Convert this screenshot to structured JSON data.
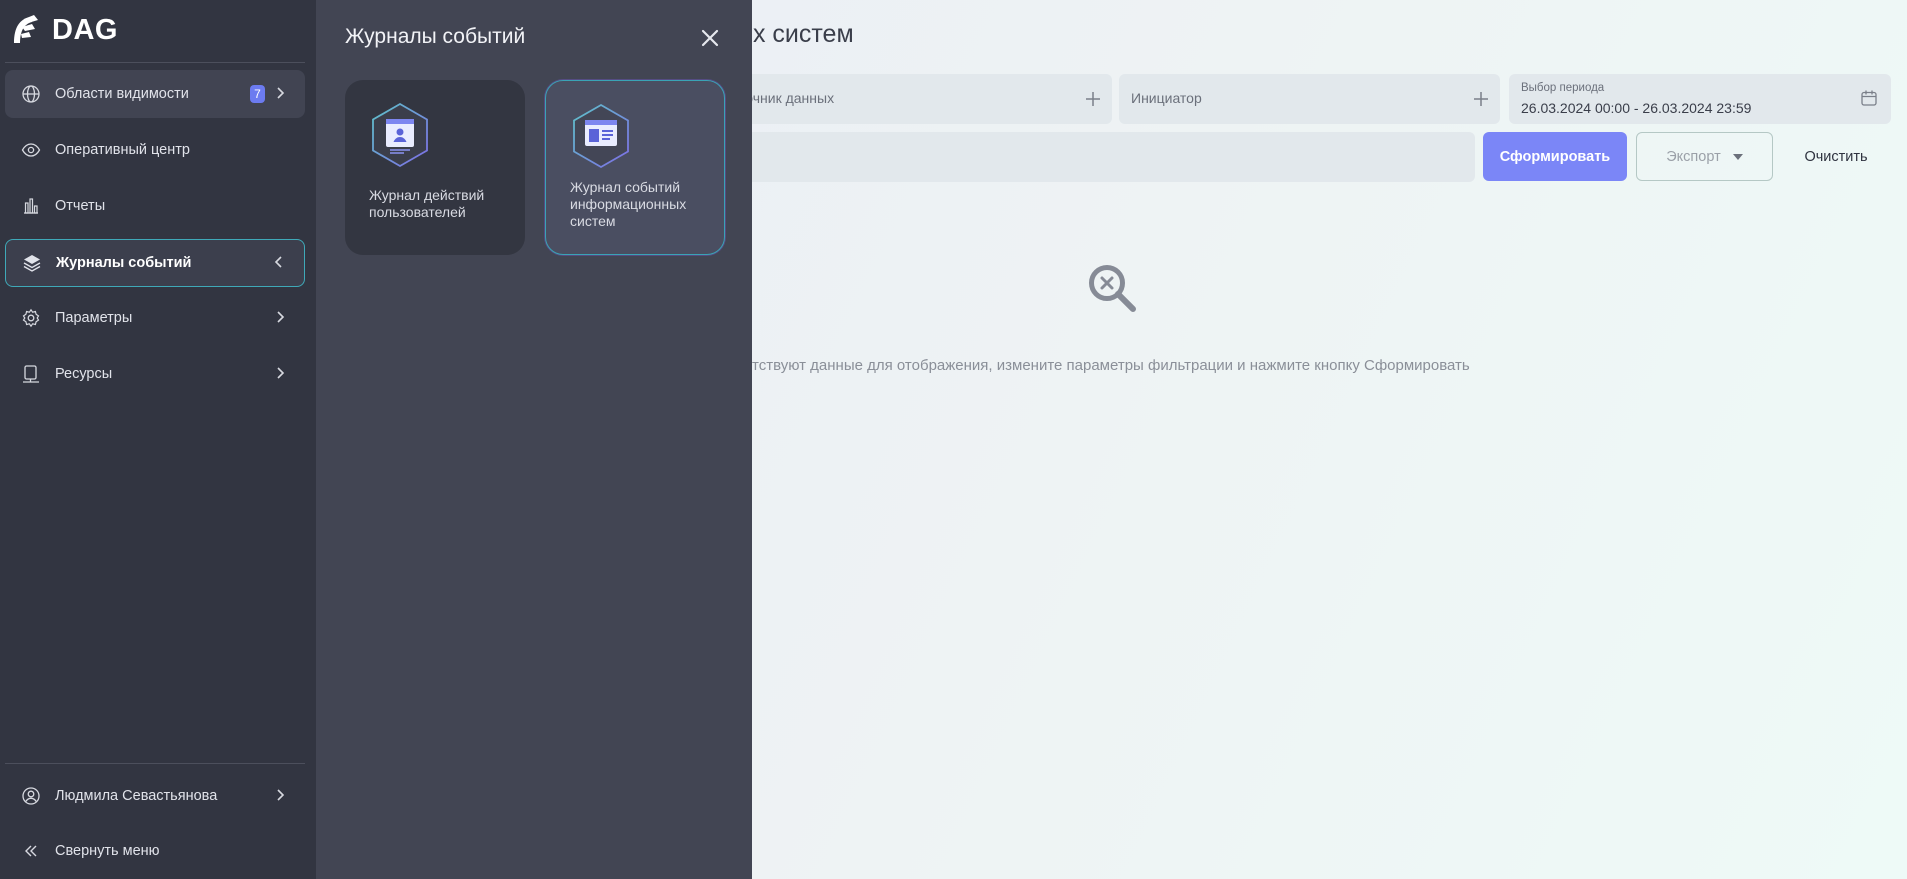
{
  "app": {
    "logo_text": "DAG"
  },
  "sidebar": {
    "items": [
      {
        "label": "Области видимости",
        "badge": "7"
      },
      {
        "label": "Оперативный центр"
      },
      {
        "label": "Отчеты"
      },
      {
        "label": "Журналы событий"
      },
      {
        "label": "Параметры"
      },
      {
        "label": "Ресурсы"
      }
    ],
    "user": {
      "name": "Людмила Севастьянова"
    },
    "collapse_label": "Свернуть меню"
  },
  "flyout": {
    "title": "Журналы событий",
    "cards": [
      {
        "label": "Журнал действий пользователей"
      },
      {
        "label": "Журнал событий информационных систем"
      }
    ]
  },
  "main": {
    "title_visible": "ых систем",
    "filters": {
      "source_placeholder": "сточник данных",
      "initiator_placeholder": "Инициатор",
      "period_label": "Выбор периода",
      "period_value": "26.03.2024 00:00 - 26.03.2024 23:59"
    },
    "buttons": {
      "generate": "Сформировать",
      "export": "Экспорт",
      "clear": "Очистить"
    },
    "empty_text": "тствуют данные для отображения, измените параметры фильтрации и нажмите кнопку Сформировать"
  },
  "colors": {
    "sidebar_bg": "#323541",
    "flyout_bg": "#424553",
    "accent": "#7b86f7",
    "active_border": "#3fa9b8"
  }
}
